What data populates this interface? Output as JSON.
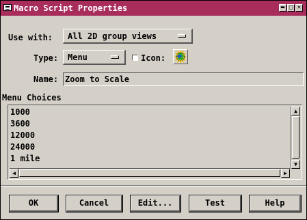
{
  "window": {
    "title": "Macro Script Properties",
    "controls": [
      "▬",
      "□",
      "✕"
    ]
  },
  "form": {
    "use_with_label": "Use with:",
    "use_with_value": "All 2D group views",
    "type_label": "Type:",
    "type_value": "Menu",
    "icon_label": "Icon:",
    "icon_checked": false,
    "name_label": "Name:",
    "name_value": "Zoom to Scale"
  },
  "menu_choices": {
    "label": "Menu Choices",
    "items": [
      "1000",
      "3600",
      "12000",
      "24000",
      "1 mile"
    ]
  },
  "buttons": {
    "ok": "OK",
    "cancel": "Cancel",
    "edit": "Edit...",
    "test": "Test",
    "help": "Help"
  },
  "colors": {
    "titlebar": "#a82c5c",
    "face": "#d4d0c8"
  }
}
